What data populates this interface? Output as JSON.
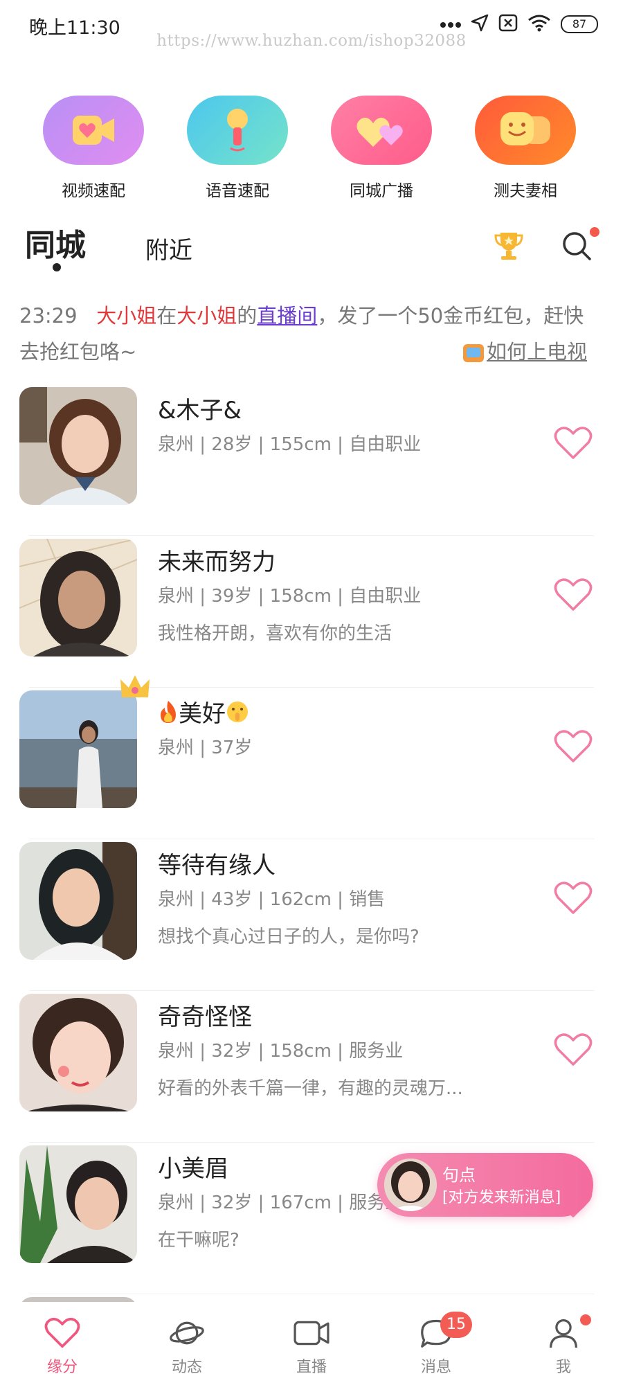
{
  "status_bar": {
    "time": "晚上11:30",
    "battery": "87",
    "watermark": "https://www.huzhan.com/ishop32088"
  },
  "quick_entries": [
    {
      "label": "视频速配",
      "icon": "video-heart-icon"
    },
    {
      "label": "语音速配",
      "icon": "microphone-icon"
    },
    {
      "label": "同城广播",
      "icon": "hearts-icon"
    },
    {
      "label": "测夫妻相",
      "icon": "couple-faces-icon"
    }
  ],
  "tabs": {
    "active": "同城",
    "other": "附近"
  },
  "notice": {
    "time": "23:29",
    "user1": "大小姐",
    "mid1": "在",
    "user2": "大小姐",
    "mid2": "的",
    "room": "直播间",
    "rest": "，发了一个50金币红包，赶快去抢红包咯~",
    "tv_link": "如何上电视"
  },
  "users": [
    {
      "name": "&木子&",
      "meta": "泉州 | 28岁 | 155cm | 自由职业",
      "bio": ""
    },
    {
      "name": "未来而努力",
      "meta": "泉州 | 39岁 | 158cm | 自由职业",
      "bio": "我性格开朗，喜欢有你的生活"
    },
    {
      "name": "美好",
      "meta": "泉州 | 37岁",
      "bio": ""
    },
    {
      "name": "等待有缘人",
      "meta": "泉州 | 43岁 | 162cm | 销售",
      "bio": "想找个真心过日子的人，是你吗?"
    },
    {
      "name": "奇奇怪怪",
      "meta": "泉州 | 32岁 | 158cm | 服务业",
      "bio": "好看的外表千篇一律，有趣的灵魂万..."
    },
    {
      "name": "小美眉",
      "meta": "泉州 | 32岁 | 167cm | 服务业",
      "bio": "在干嘛呢?"
    }
  ],
  "float_message": {
    "name": "句点",
    "text": "[对方发来新消息]"
  },
  "bottom_nav": [
    {
      "label": "缘分"
    },
    {
      "label": "动态"
    },
    {
      "label": "直播"
    },
    {
      "label": "消息",
      "badge": "15"
    },
    {
      "label": "我"
    }
  ],
  "colors": {
    "accent": "#f0577e",
    "badge": "#f25c54",
    "notice_red": "#e0393b",
    "notice_link": "#6a3ccf"
  }
}
